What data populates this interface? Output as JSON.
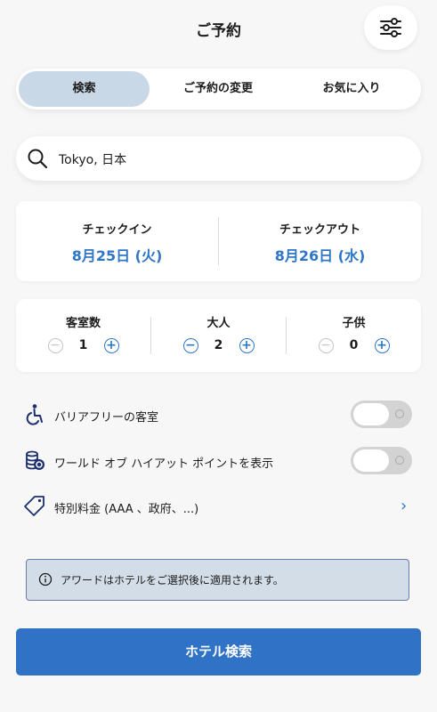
{
  "header": {
    "title": "ご予約",
    "filter_icon": "sliders-icon"
  },
  "tabs": [
    {
      "label": "検索",
      "active": true
    },
    {
      "label": "ご予約の変更",
      "active": false
    },
    {
      "label": "お気に入り",
      "active": false
    }
  ],
  "search": {
    "value": "Tokyo, 日本",
    "icon": "search-icon"
  },
  "dates": {
    "checkin_label": "チェックイン",
    "checkin_value": "8月25日 (火)",
    "checkout_label": "チェックアウト",
    "checkout_value": "8月26日 (水)"
  },
  "counts": [
    {
      "label": "客室数",
      "value": "1",
      "minus_enabled": false
    },
    {
      "label": "大人",
      "value": "2",
      "minus_enabled": true
    },
    {
      "label": "子供",
      "value": "0",
      "minus_enabled": false
    }
  ],
  "options": {
    "accessible_label": "バリアフリーの客室",
    "accessible_on": false,
    "points_label": "ワールド オブ ハイアット ポイントを表示",
    "points_on": false,
    "special_rates_label": "特別料金 (AAA 、政府、...)"
  },
  "notice": {
    "text": "アワードはホテルをご選択後に適用されます。"
  },
  "cta": {
    "label": "ホテル検索"
  },
  "colors": {
    "accent": "#2f76c6",
    "button": "#2f72c6",
    "active_tab": "#c9d8e6",
    "notice_bg": "#d3dde7"
  }
}
